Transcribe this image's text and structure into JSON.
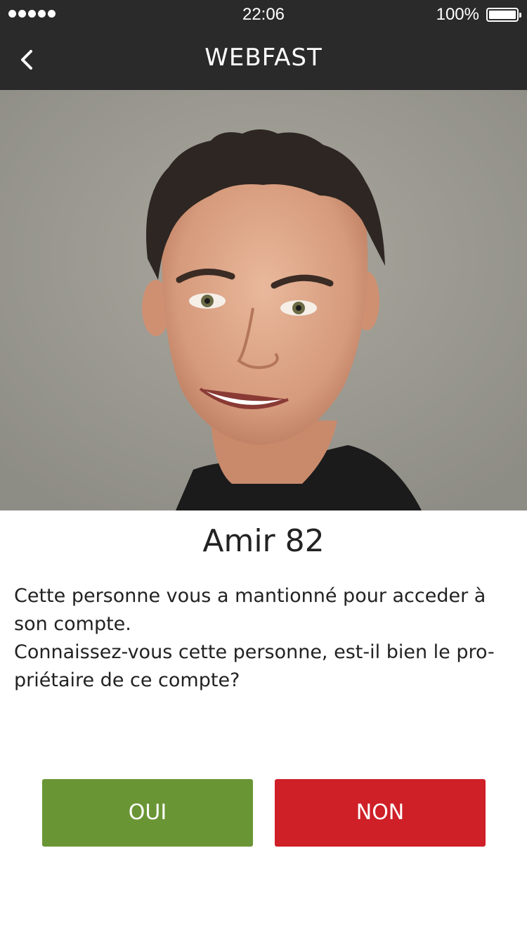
{
  "status_bar": {
    "time": "22:06",
    "battery_percent": "100%",
    "signal_bars": 5
  },
  "nav": {
    "title": "WEBFAST",
    "back_icon": "chevron-left-icon"
  },
  "profile": {
    "name": "Amir 82",
    "message_line1": "Cette personne vous a mantionné pour acceder à son compte.",
    "message_line2": "Connaissez-vous cette personne, est-il bien le pro-priétaire de ce compte?"
  },
  "actions": {
    "yes_label": "OUI",
    "no_label": "NON"
  },
  "colors": {
    "bar_background": "#2a2a2a",
    "yes_button": "#6a9535",
    "no_button": "#cf1f27",
    "photo_background": "#9a9990"
  }
}
